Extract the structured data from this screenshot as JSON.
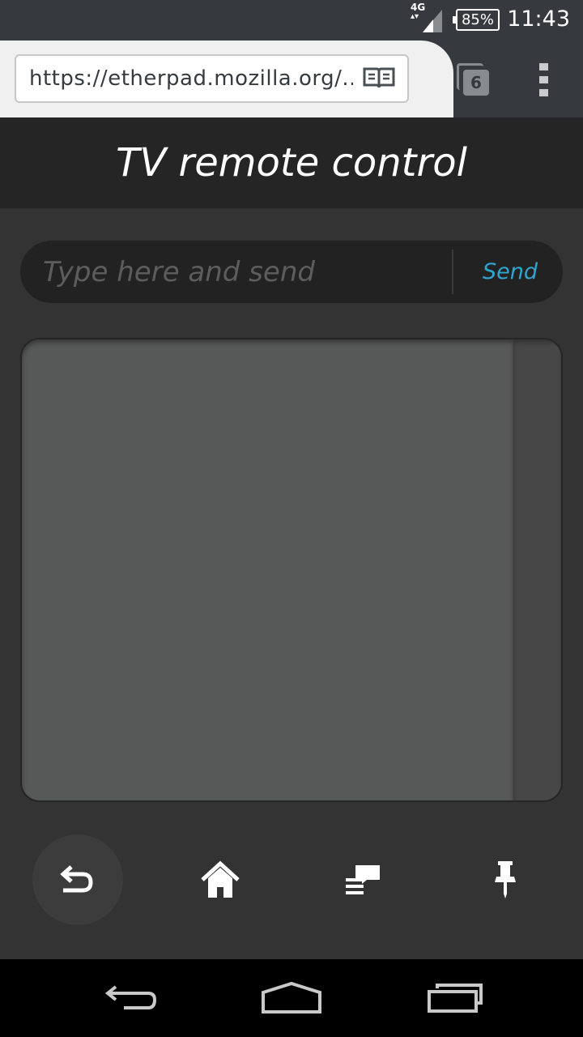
{
  "status_bar": {
    "network": "4G",
    "battery": "85%",
    "time": "11:43",
    "icons": [
      "signal-icon",
      "battery-icon"
    ]
  },
  "browser": {
    "url": "https://etherpad.mozilla.org/...",
    "tab_count": "6",
    "icons": [
      "reader-mode-icon",
      "tabs-icon",
      "overflow-menu-icon"
    ]
  },
  "app": {
    "title": "TV remote control",
    "input_placeholder": "Type here and send",
    "input_value": "",
    "send_label": "Send",
    "controls": [
      {
        "icon": "back-icon",
        "active": true
      },
      {
        "icon": "home-icon",
        "active": false
      },
      {
        "icon": "menu-list-icon",
        "active": false
      },
      {
        "icon": "pin-icon",
        "active": false
      }
    ],
    "colors": {
      "accent": "#2fa5cf",
      "header_bg": "#252525",
      "background": "#333333"
    }
  },
  "system_nav": {
    "icons": [
      "back-nav-icon",
      "home-nav-icon",
      "recents-nav-icon"
    ]
  }
}
